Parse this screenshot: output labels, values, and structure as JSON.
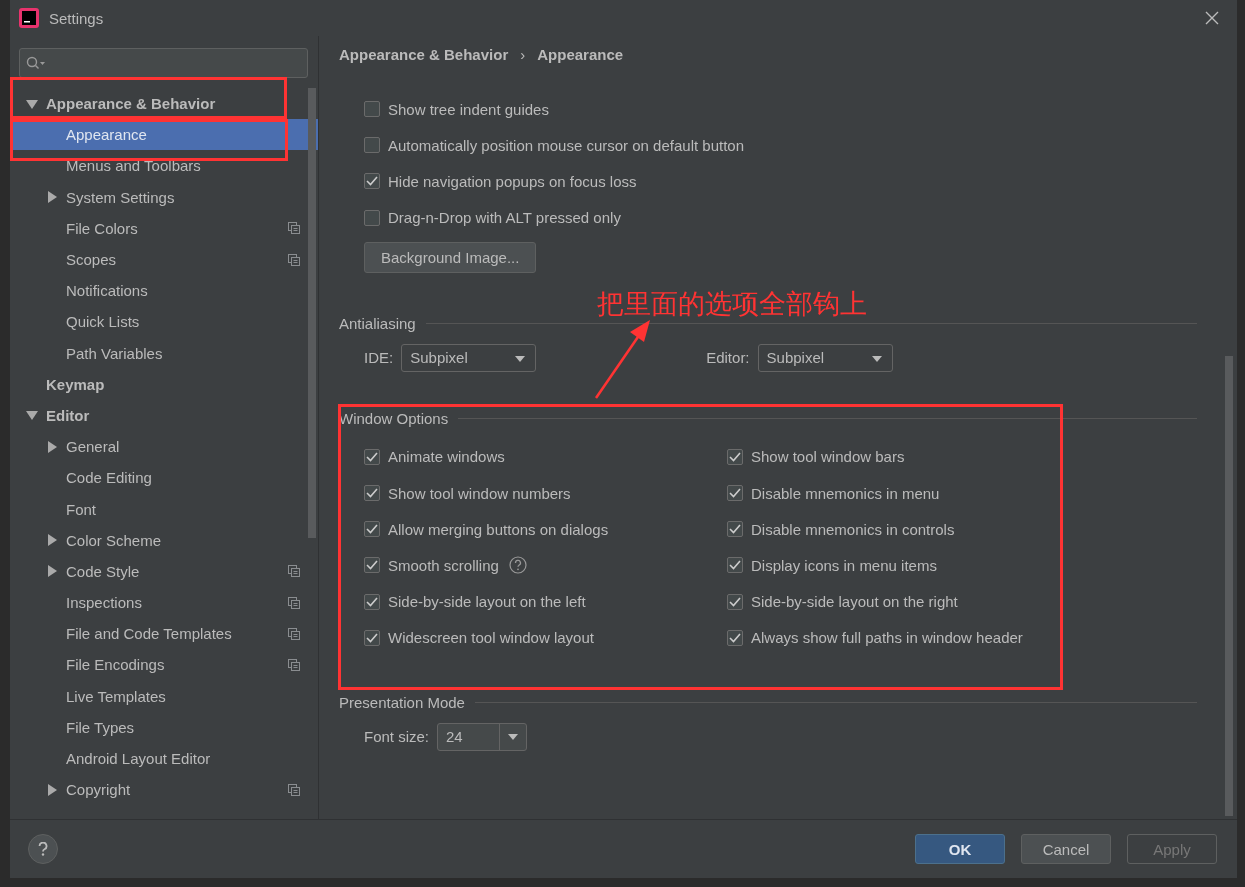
{
  "window": {
    "title": "Settings"
  },
  "sidebar": {
    "items": [
      {
        "label": "Appearance & Behavior",
        "bold": true,
        "expanded": true,
        "selected": false,
        "children": [
          {
            "label": "Appearance",
            "selected": true,
            "shared": false
          },
          {
            "label": "Menus and Toolbars",
            "selected": false,
            "shared": false
          },
          {
            "label": "System Settings",
            "selected": false,
            "expanded": false,
            "shared": false
          },
          {
            "label": "File Colors",
            "selected": false,
            "shared": true
          },
          {
            "label": "Scopes",
            "selected": false,
            "shared": true
          },
          {
            "label": "Notifications",
            "selected": false,
            "shared": false
          },
          {
            "label": "Quick Lists",
            "selected": false,
            "shared": false
          },
          {
            "label": "Path Variables",
            "selected": false,
            "shared": false
          }
        ]
      },
      {
        "label": "Keymap",
        "bold": true,
        "selected": false
      },
      {
        "label": "Editor",
        "bold": true,
        "expanded": true,
        "selected": false,
        "children": [
          {
            "label": "General",
            "selected": false,
            "expanded": false,
            "shared": false
          },
          {
            "label": "Code Editing",
            "selected": false,
            "shared": false
          },
          {
            "label": "Font",
            "selected": false,
            "shared": false
          },
          {
            "label": "Color Scheme",
            "selected": false,
            "expanded": false,
            "shared": false
          },
          {
            "label": "Code Style",
            "selected": false,
            "expanded": false,
            "shared": true
          },
          {
            "label": "Inspections",
            "selected": false,
            "shared": true
          },
          {
            "label": "File and Code Templates",
            "selected": false,
            "shared": true
          },
          {
            "label": "File Encodings",
            "selected": false,
            "shared": true
          },
          {
            "label": "Live Templates",
            "selected": false,
            "shared": false
          },
          {
            "label": "File Types",
            "selected": false,
            "shared": false
          },
          {
            "label": "Android Layout Editor",
            "selected": false,
            "shared": false
          },
          {
            "label": "Copyright",
            "selected": false,
            "expanded": false,
            "shared": true
          }
        ]
      }
    ]
  },
  "breadcrumb": {
    "separator": "›",
    "items": [
      "Appearance & Behavior",
      "Appearance"
    ]
  },
  "options": [
    {
      "label": "Show tree indent guides",
      "checked": false
    },
    {
      "label": "Automatically position mouse cursor on default button",
      "checked": false
    },
    {
      "label": "Hide navigation popups on focus loss",
      "checked": true
    },
    {
      "label": "Drag-n-Drop with ALT pressed only",
      "checked": false
    }
  ],
  "background_button": "Background Image...",
  "antialiasing": {
    "title": "Antialiasing",
    "fields": [
      {
        "label": "IDE:",
        "value": "Subpixel"
      },
      {
        "label": "Editor:",
        "value": "Subpixel"
      }
    ]
  },
  "window_options": {
    "title": "Window Options",
    "columns": [
      [
        {
          "label": "Animate windows",
          "checked": true,
          "help": false
        },
        {
          "label": "Show tool window numbers",
          "checked": true,
          "help": false
        },
        {
          "label": "Allow merging buttons on dialogs",
          "checked": true,
          "help": false
        },
        {
          "label": "Smooth scrolling",
          "checked": true,
          "help": true
        },
        {
          "label": "Side-by-side layout on the left",
          "checked": true,
          "help": false
        },
        {
          "label": "Widescreen tool window layout",
          "checked": true,
          "help": false
        }
      ],
      [
        {
          "label": "Show tool window bars",
          "checked": true,
          "help": false
        },
        {
          "label": "Disable mnemonics in menu",
          "checked": true,
          "help": false
        },
        {
          "label": "Disable mnemonics in controls",
          "checked": true,
          "help": false
        },
        {
          "label": "Display icons in menu items",
          "checked": true,
          "help": false
        },
        {
          "label": "Side-by-side layout on the right",
          "checked": true,
          "help": false
        },
        {
          "label": "Always show full paths in window header",
          "checked": true,
          "help": false
        }
      ]
    ]
  },
  "presentation": {
    "title": "Presentation Mode",
    "label": "Font size:",
    "value": "24"
  },
  "annotation": {
    "text": "把里面的选项全部钩上"
  },
  "buttons": [
    {
      "label": "OK",
      "kind": "primary",
      "disabled": false
    },
    {
      "label": "Cancel",
      "kind": "normal",
      "disabled": false
    },
    {
      "label": "Apply",
      "kind": "normal",
      "disabled": true
    }
  ]
}
